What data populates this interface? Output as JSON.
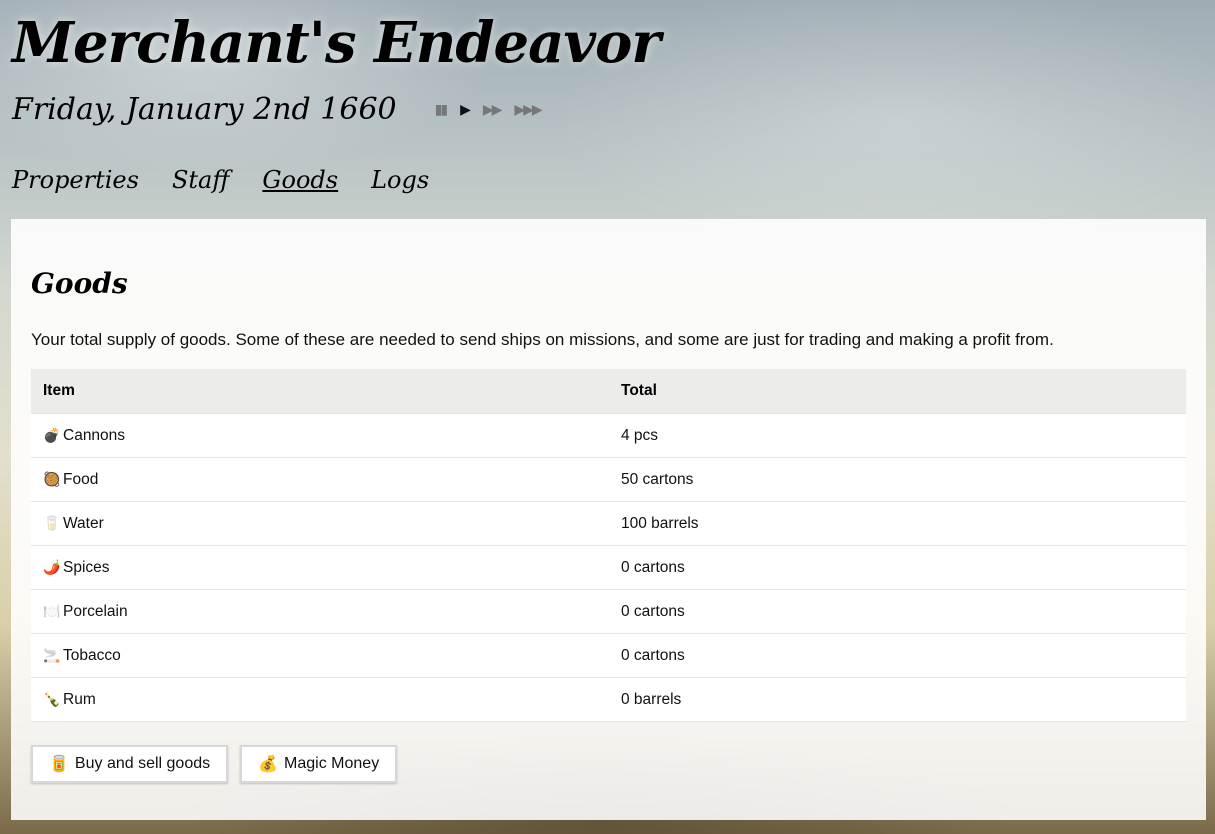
{
  "app": {
    "title": "Merchant's Endeavor",
    "date": "Friday, January 2nd 1660"
  },
  "speed_controls": [
    {
      "name": "pause",
      "glyph": "▮▮",
      "active": false
    },
    {
      "name": "play",
      "glyph": "▶",
      "active": true
    },
    {
      "name": "fast",
      "glyph": "▶▶",
      "active": false
    },
    {
      "name": "fastest",
      "glyph": "▶▶▶",
      "active": false
    }
  ],
  "nav": {
    "items": [
      {
        "label": "Properties",
        "current": false
      },
      {
        "label": "Staff",
        "current": false
      },
      {
        "label": "Goods",
        "current": true
      },
      {
        "label": "Logs",
        "current": false
      }
    ]
  },
  "goods": {
    "heading": "Goods",
    "description": "Your total supply of goods. Some of these are needed to send ships on missions, and some are just for trading and making a profit from.",
    "columns": [
      "Item",
      "Total"
    ],
    "rows": [
      {
        "icon": "💣",
        "icon_name": "bomb-icon",
        "item": "Cannons",
        "total": "4 pcs"
      },
      {
        "icon": "🥘",
        "icon_name": "food-icon",
        "item": "Food",
        "total": "50 cartons"
      },
      {
        "icon": "🥛",
        "icon_name": "water-glass-icon",
        "item": "Water",
        "total": "100 barrels"
      },
      {
        "icon": "🌶️",
        "icon_name": "chili-pepper-icon",
        "item": "Spices",
        "total": "0 cartons"
      },
      {
        "icon": "🍽️",
        "icon_name": "plate-icon",
        "item": "Porcelain",
        "total": "0 cartons"
      },
      {
        "icon": "🚬",
        "icon_name": "cigarette-icon",
        "item": "Tobacco",
        "total": "0 cartons"
      },
      {
        "icon": "🍾",
        "icon_name": "bottle-icon",
        "item": "Rum",
        "total": "0 barrels"
      }
    ],
    "buttons": [
      {
        "icon": "🥫",
        "icon_name": "can-icon",
        "label": "Buy and sell goods"
      },
      {
        "icon": "💰",
        "icon_name": "money-bag-icon",
        "label": "Magic Money"
      }
    ]
  }
}
